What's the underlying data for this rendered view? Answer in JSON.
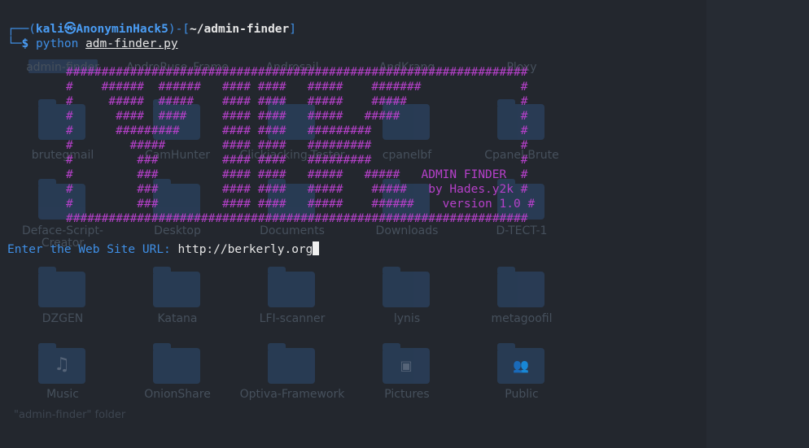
{
  "file_manager": {
    "folders_row1": [
      {
        "label": "admin-finder"
      },
      {
        "label": "AndroRuse_Frame"
      },
      {
        "label": "Androsail"
      },
      {
        "label": "AndKrang"
      },
      {
        "label": "Ploxy"
      }
    ],
    "folders_row2": [
      {
        "label": "brutegmail"
      },
      {
        "label": "CamHunter"
      },
      {
        "label": "Clickjacking-Tester"
      },
      {
        "label": "cpanelbf"
      },
      {
        "label": "Cpanel-Brute"
      }
    ],
    "folders_row3": [
      {
        "label": "Deface-Script-"
      },
      {
        "label": "Desktop"
      },
      {
        "label": "Documents"
      },
      {
        "label": "Downloads"
      },
      {
        "label": "D-TECT-1"
      }
    ],
    "folders_row3_extra": "Creator",
    "folders_row4": [
      {
        "label": "DZGEN"
      },
      {
        "label": "Katana"
      },
      {
        "label": "LFI-scanner"
      },
      {
        "label": "lynis"
      },
      {
        "label": "metagoofil"
      }
    ],
    "folders_row5": [
      {
        "label": "Music",
        "icon": "music-icon"
      },
      {
        "label": "OnionShare"
      },
      {
        "label": "Optiva-Framework"
      },
      {
        "label": "Pictures",
        "icon": "image-icon"
      },
      {
        "label": "Public",
        "icon": "people-icon"
      }
    ],
    "status": "\"admin-finder\" folder"
  },
  "terminal": {
    "prompt_open": "┌──(",
    "user": "kali",
    "at": "㉿",
    "host": "AnonyminHack5",
    "prompt_mid": ")-[",
    "cwd": "~/admin-finder",
    "prompt_close": "]",
    "prompt2": "└─",
    "dollar": "$",
    "command": "python",
    "command_arg": "adm-finder.py",
    "banner": [
      "#################################################################",
      "#    ######  ######   #### ####   #####    #######              #",
      "#     #####  #####    #### ####   #####    #####                #",
      "#      ####  ####     #### ####   #####   #####                 #",
      "#      #########      #### ####   #########                     #",
      "#        #####        #### ####   #########                     #",
      "#         ###         #### ####   #########                     #",
      "#         ###         #### ####   #####   #####   ADMIN FINDER  #",
      "#         ###         #### ####   #####    #####   by Hades.y2k #",
      "#         ###         #### ####   #####    ######    version 1.0 #",
      "#################################################################"
    ],
    "url_prompt": "Enter the Web Site URL: ",
    "url_value": "http://berkerly.org"
  }
}
